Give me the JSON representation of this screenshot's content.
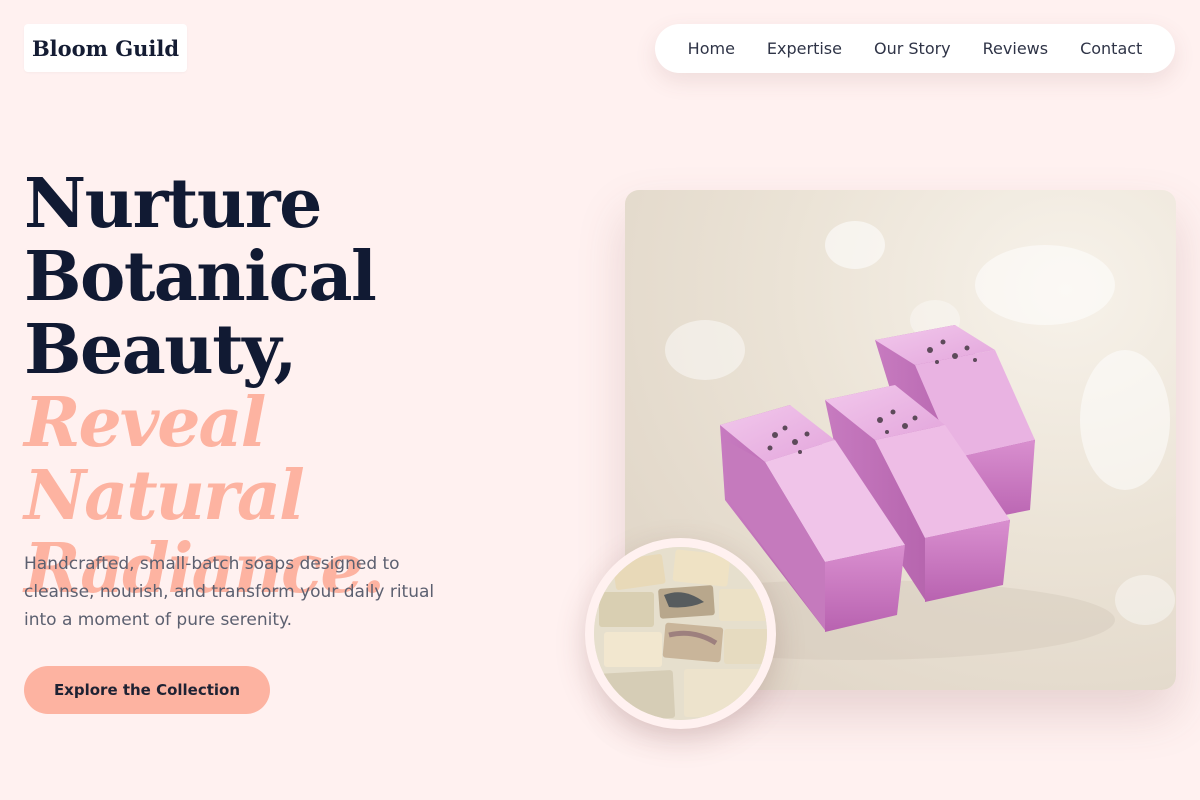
{
  "brand": {
    "name": "Bloom Guild"
  },
  "nav": {
    "items": [
      {
        "label": "Home"
      },
      {
        "label": "Expertise"
      },
      {
        "label": "Our Story"
      },
      {
        "label": "Reviews"
      },
      {
        "label": "Contact"
      }
    ]
  },
  "hero": {
    "headline_lines": [
      "Nurture",
      "Botanical",
      "Beauty,"
    ],
    "accent_lines": [
      "Reveal Natural",
      "Radiance."
    ],
    "description": "Handcrafted, small-batch soaps designed to cleanse, nourish, and transform your daily ritual into a moment of pure serenity.",
    "cta_label": "Explore the Collection"
  },
  "colors": {
    "background": "#fff1f0",
    "headline": "#111a33",
    "accent": "#fdb3a1",
    "body_text": "#5c6070"
  },
  "images": {
    "main": "lavender-soap-bars-photo",
    "secondary": "assorted-soap-bars-photo"
  }
}
